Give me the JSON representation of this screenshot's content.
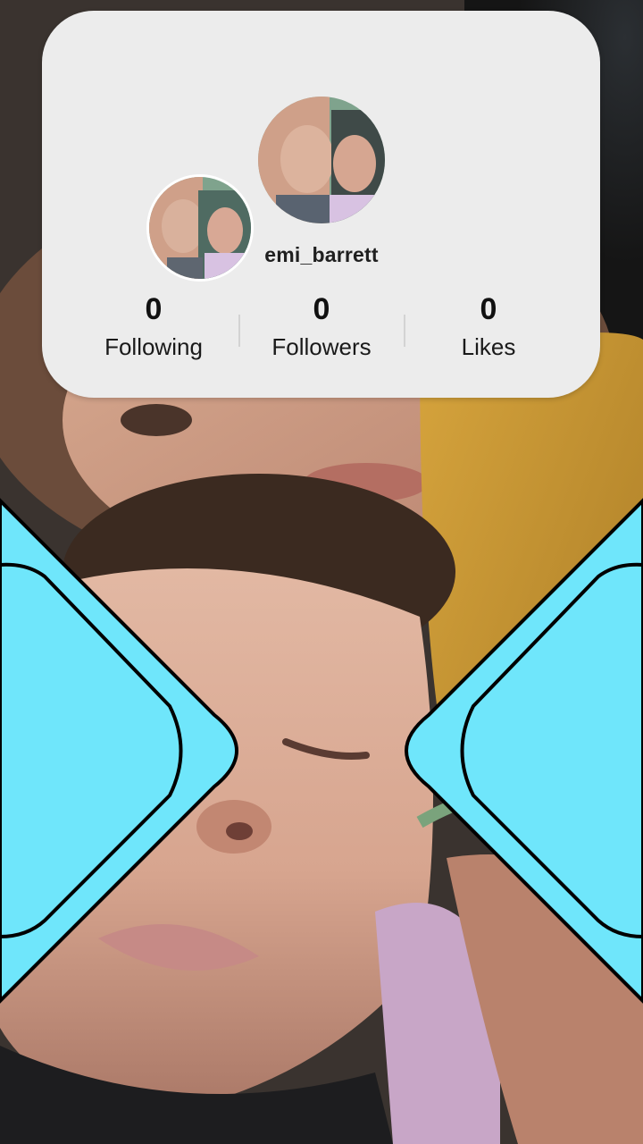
{
  "profile": {
    "username": "emi_barrett",
    "avatar_main_icon": "profile-photo",
    "avatar_small_icon": "profile-photo"
  },
  "stats": {
    "following": {
      "value": "0",
      "label": "Following"
    },
    "followers": {
      "value": "0",
      "label": "Followers"
    },
    "likes": {
      "value": "0",
      "label": "Likes"
    }
  },
  "colors": {
    "card": "#ececec",
    "frame_accent": "#6fe6fb",
    "frame_outline": "#000000"
  }
}
